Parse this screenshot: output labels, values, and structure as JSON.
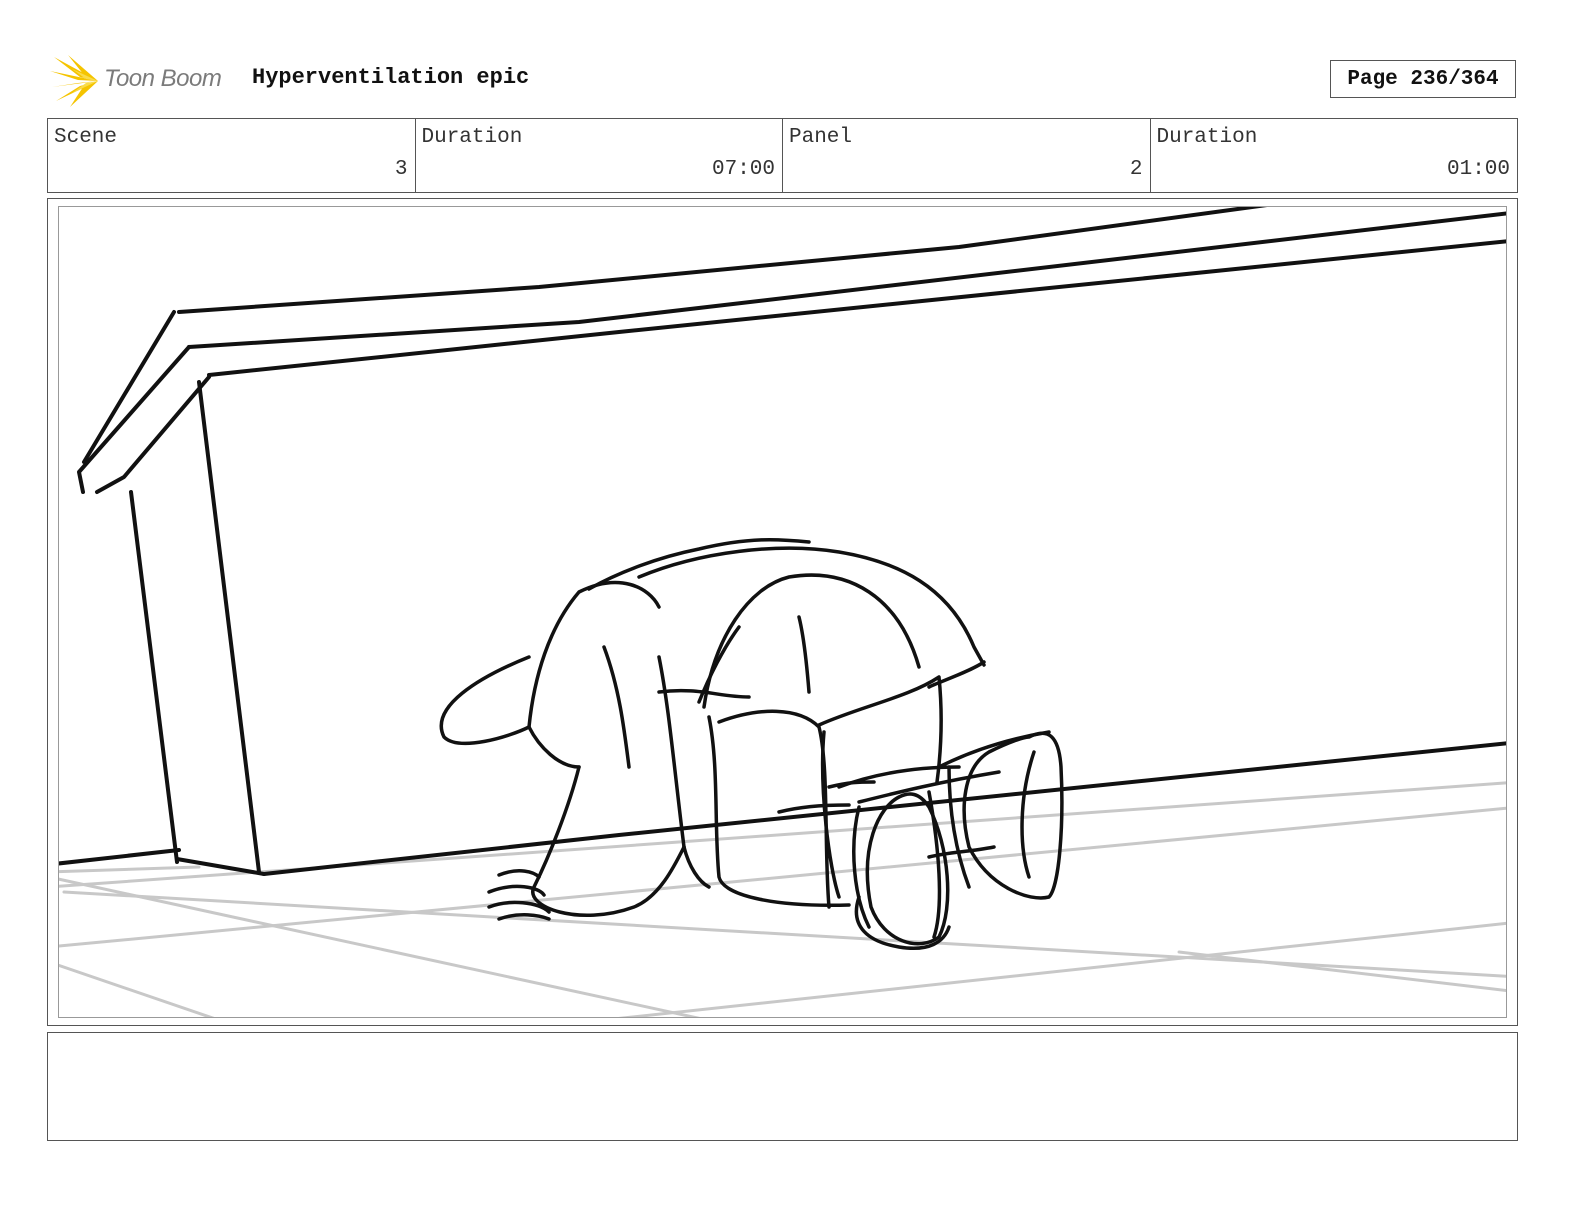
{
  "header": {
    "logo_text": "Toon Boom",
    "title": "Hyperventilation epic",
    "page_label": "Page 236/364"
  },
  "info": [
    {
      "label": "Scene",
      "value": "3"
    },
    {
      "label": "Duration",
      "value": "07:00"
    },
    {
      "label": "Panel",
      "value": "2"
    },
    {
      "label": "Duration",
      "value": "01:00"
    }
  ],
  "panel": {
    "drawing_icon": "storyboard-sketch",
    "colors": {
      "ink": "#111111",
      "floor_guides": "#c8c8c8",
      "logo_accent": "#f5c400"
    }
  },
  "notes": {
    "text": ""
  }
}
